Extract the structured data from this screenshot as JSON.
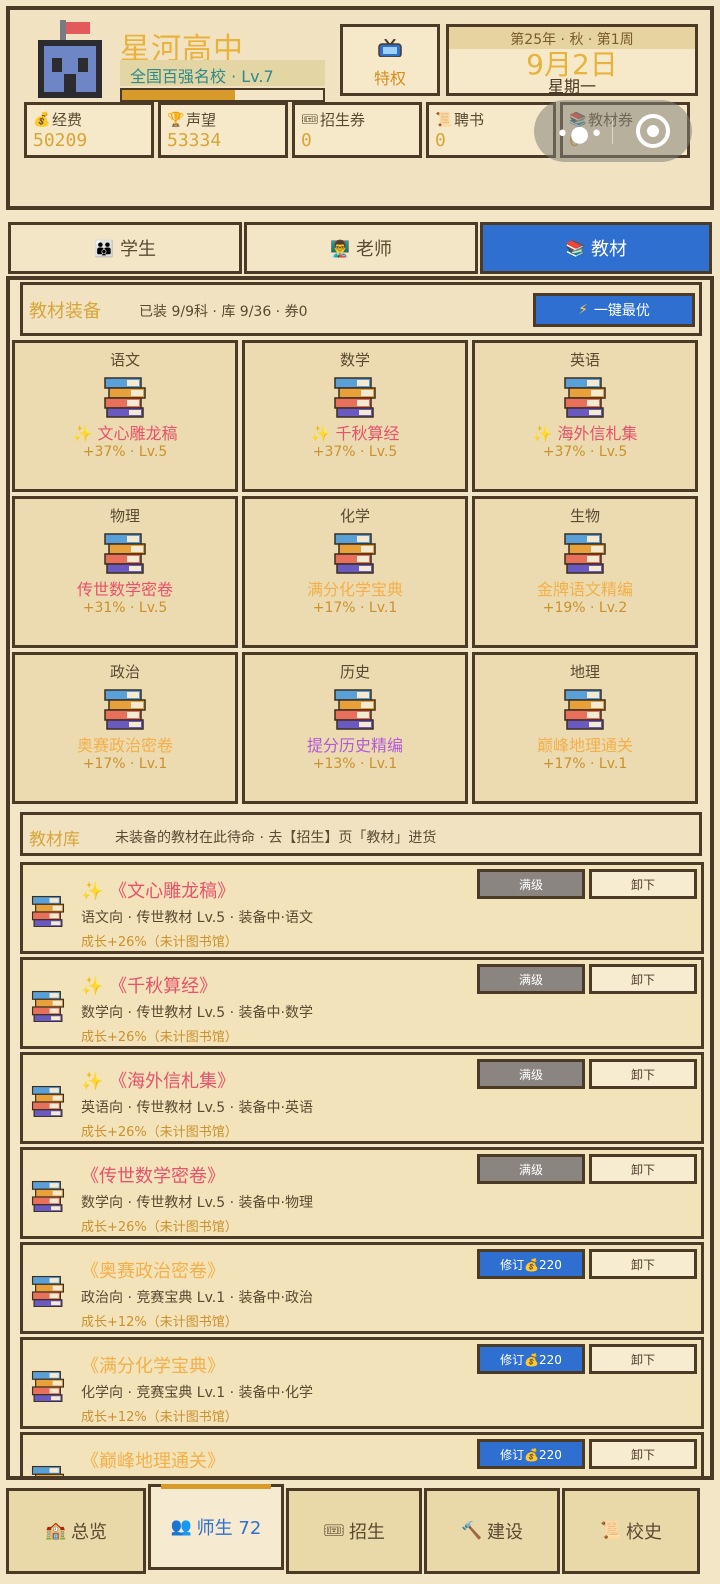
{
  "header": {
    "school_name": "星河高中",
    "school_rank": "全国百强名校 · Lv.7",
    "xp_fraction": 0.56,
    "perk_label": "特权",
    "season_line": "第25年 · 秋 · 第1周",
    "date": "9月2日",
    "weekday": "星期一"
  },
  "resources": [
    {
      "label": "经费",
      "value": "50209",
      "icon": "money-bag-icon"
    },
    {
      "label": "声望",
      "value": "53334",
      "icon": "trophy-icon"
    },
    {
      "label": "招生券",
      "value": "0",
      "icon": "ticket-icon"
    },
    {
      "label": "聘书",
      "value": "0",
      "icon": "scroll-icon"
    },
    {
      "label": "教材券",
      "value": "0",
      "icon": "book-ticket-icon"
    }
  ],
  "tabs": [
    {
      "label": "学生",
      "icon": "student-icon"
    },
    {
      "label": "老师",
      "icon": "teacher-icon"
    },
    {
      "label": "教材",
      "icon": "textbook-icon",
      "active": true
    }
  ],
  "equip": {
    "title": "教材装备",
    "stats": "已装 9/9科 · 库 9/36 · 券0",
    "optimize_label": "一键最优"
  },
  "slots": [
    {
      "subject": "语文",
      "book": "✨ 文心雕龙稿",
      "stat": "+37% · Lv.5",
      "color": "#e8526a"
    },
    {
      "subject": "数学",
      "book": "✨ 千秋算经",
      "stat": "+37% · Lv.5",
      "color": "#e8526a"
    },
    {
      "subject": "英语",
      "book": "✨ 海外信札集",
      "stat": "+37% · Lv.5",
      "color": "#e8526a"
    },
    {
      "subject": "物理",
      "book": "传世数学密卷",
      "stat": "+31% · Lv.5",
      "color": "#e8526a"
    },
    {
      "subject": "化学",
      "book": "满分化学宝典",
      "stat": "+17% · Lv.1",
      "color": "#f3b04a"
    },
    {
      "subject": "生物",
      "book": "金牌语文精编",
      "stat": "+19% · Lv.2",
      "color": "#f3b04a"
    },
    {
      "subject": "政治",
      "book": "奥赛政治密卷",
      "stat": "+17% · Lv.1",
      "color": "#f3b04a"
    },
    {
      "subject": "历史",
      "book": "提分历史精编",
      "stat": "+13% · Lv.1",
      "color": "#b25ad8"
    },
    {
      "subject": "地理",
      "book": "巅峰地理通关",
      "stat": "+17% · Lv.1",
      "color": "#f3b04a"
    }
  ],
  "library": {
    "title": "教材库",
    "desc": "未装备的教材在此待命 · 去【招生】页「教材」进货",
    "unequip_label": "卸下",
    "max_label": "满级",
    "upgrade_label": "修订💰220",
    "books": [
      {
        "title": "✨ 《文心雕龙稿》",
        "meta": "语文向 · 传世教材 Lv.5 · 装备中·语文",
        "growth": "成长+26%（未计图书馆）",
        "color": "#e8526a",
        "maxed": true
      },
      {
        "title": "✨ 《千秋算经》",
        "meta": "数学向 · 传世教材 Lv.5 · 装备中·数学",
        "growth": "成长+26%（未计图书馆）",
        "color": "#e8526a",
        "maxed": true
      },
      {
        "title": "✨ 《海外信札集》",
        "meta": "英语向 · 传世教材 Lv.5 · 装备中·英语",
        "growth": "成长+26%（未计图书馆）",
        "color": "#e8526a",
        "maxed": true
      },
      {
        "title": "《传世数学密卷》",
        "meta": "数学向 · 传世教材 Lv.5 · 装备中·物理",
        "growth": "成长+26%（未计图书馆）",
        "color": "#e8526a",
        "maxed": true
      },
      {
        "title": "《奥赛政治密卷》",
        "meta": "政治向 · 竞赛宝典 Lv.1 · 装备中·政治",
        "growth": "成长+12%（未计图书馆）",
        "color": "#f3b04a",
        "maxed": false
      },
      {
        "title": "《满分化学宝典》",
        "meta": "化学向 · 竞赛宝典 Lv.1 · 装备中·化学",
        "growth": "成长+12%（未计图书馆）",
        "color": "#f3b04a",
        "maxed": false
      },
      {
        "title": "《巅峰地理通关》",
        "meta": "",
        "growth": "",
        "color": "#f3b04a",
        "maxed": false
      }
    ]
  },
  "bottom_nav": [
    {
      "label": "总览",
      "icon": "building-icon"
    },
    {
      "label": "师生 72",
      "icon": "people-icon",
      "active": true
    },
    {
      "label": "招生",
      "icon": "ticket-icon"
    },
    {
      "label": "建设",
      "icon": "hammer-icon"
    },
    {
      "label": "校史",
      "icon": "scroll-icon"
    }
  ]
}
